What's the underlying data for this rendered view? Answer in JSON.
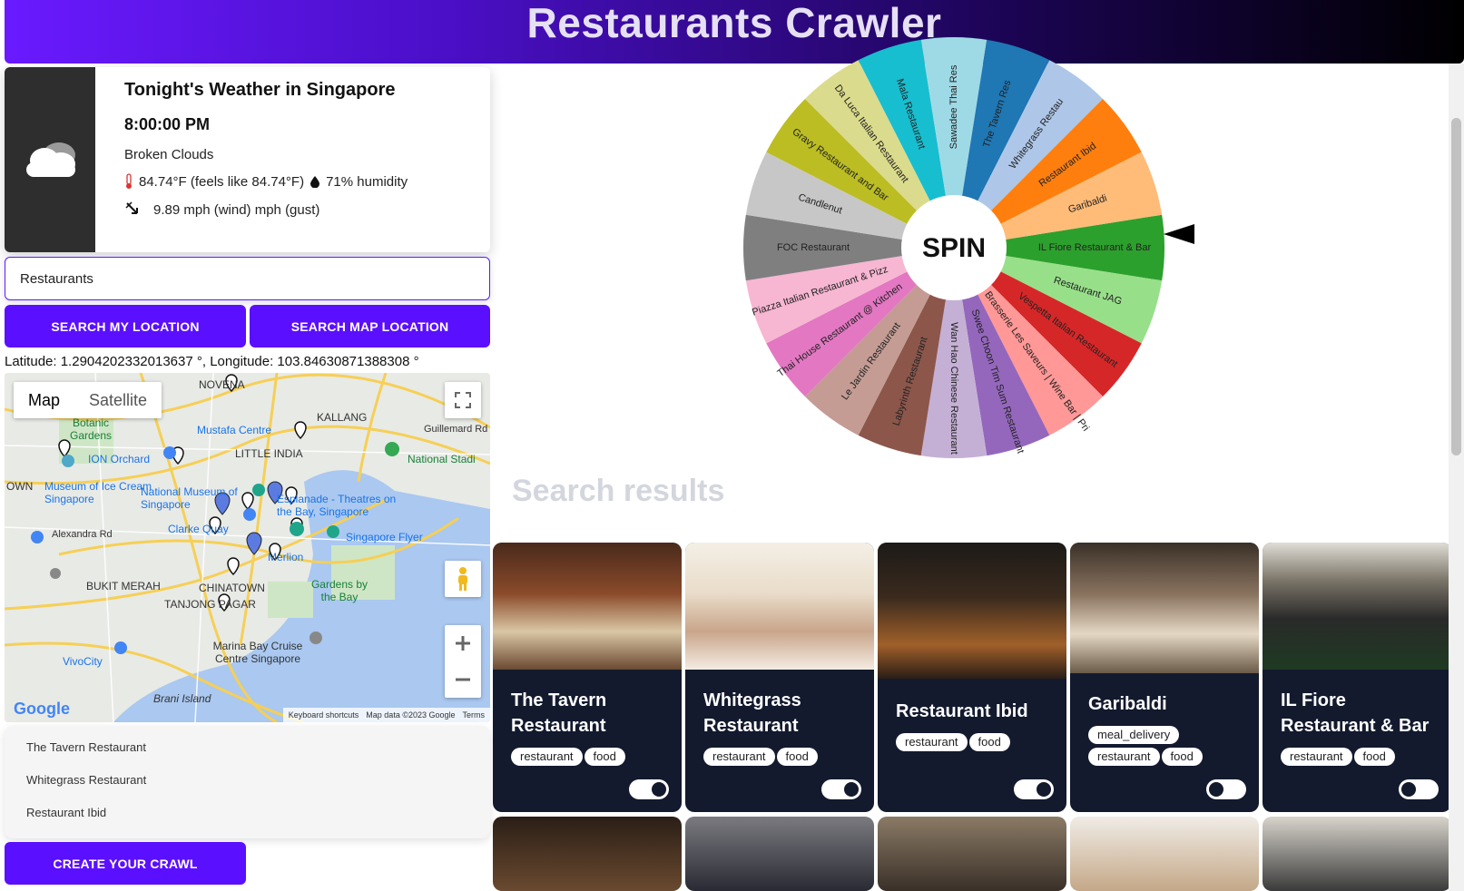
{
  "header": {
    "title": "Restaurants Crawler"
  },
  "weather": {
    "title": "Tonight's Weather in Singapore",
    "time": "8:00:00 PM",
    "description": "Broken Clouds",
    "temp_line": "84.74°F (feels like 84.74°F)",
    "humidity_line": "71% humidity",
    "wind_line": "9.89 mph (wind) mph (gust)"
  },
  "search": {
    "value": "Restaurants",
    "placeholder": ""
  },
  "buttons": {
    "search_my_location": "SEARCH MY LOCATION",
    "search_map_location": "SEARCH MAP LOCATION",
    "create_crawl": "CREATE YOUR CRAWL"
  },
  "coords": "Latitude: 1.2904202332013637 °, Longitude: 103.84630871388308 °",
  "map": {
    "toggle_map": "Map",
    "toggle_satellite": "Satellite",
    "labels": {
      "novena": "NOVENA",
      "botanic": "Botanic Gardens",
      "mustafa": "Mustafa Centre",
      "kallang": "KALLANG",
      "guillemard": "Guillemard Rd",
      "little_india": "LITTLE INDIA",
      "national_stadium": "National Stadi",
      "ion": "ION Orchard",
      "museum": "Museum of Ice Cream Singapore",
      "national_museum": "National Museum of Singapore",
      "esplanade": "Esplanade - Theatres on the Bay, Singapore",
      "clarke": "Clarke Quay",
      "merlion": "Merlion",
      "flyer": "Singapore Flyer",
      "alexandra": "Alexandra Rd",
      "bukit_merah": "BUKIT MERAH",
      "chinatown": "CHINATOWN",
      "tanjong": "TANJONG PAGAR",
      "gardens_bay": "Gardens by the Bay",
      "marina": "Marina Bay Cruise Centre Singapore",
      "vivocity": "VivoCity",
      "brani": "Brani Island",
      "town": "OWN"
    },
    "footer": {
      "shortcuts": "Keyboard shortcuts",
      "data": "Map data ©2023 Google",
      "terms": "Terms"
    },
    "logo": "Google"
  },
  "selected_list": [
    "The Tavern Restaurant",
    "Whitegrass Restaurant",
    "Restaurant Ibid"
  ],
  "wheel": {
    "center_label": "SPIN",
    "segments": [
      {
        "label": "IL Fiore Restaurant & Bar",
        "color": "#2ca02c"
      },
      {
        "label": "Restaurant JAG",
        "color": "#98df8a"
      },
      {
        "label": "Vespetta Italian Restaurant",
        "color": "#d62728"
      },
      {
        "label": "Brasserie Les Saveurs | Wine Bar | Pri",
        "color": "#ff9896"
      },
      {
        "label": "Swee Choon Tim Sum Restaurant",
        "color": "#9467bd"
      },
      {
        "label": "Wan Hao Chinese Restaurant",
        "color": "#c5b0d5"
      },
      {
        "label": "Labyrinth Restaurant",
        "color": "#8c564b"
      },
      {
        "label": "Le Jardin Restaurant",
        "color": "#c49c94"
      },
      {
        "label": "Thai House Restaurant @ Kitchen",
        "color": "#e377c2"
      },
      {
        "label": "Piazza Italian Restaurant & Pizz",
        "color": "#f7b6d2"
      },
      {
        "label": "FOC Restaurant",
        "color": "#7f7f7f"
      },
      {
        "label": "Candlenut",
        "color": "#c7c7c7"
      },
      {
        "label": "Gravy Restaurant and Bar",
        "color": "#bcbd22"
      },
      {
        "label": "Da Luca Italian Restaurant",
        "color": "#dbdb8d"
      },
      {
        "label": "Mala Restaurant",
        "color": "#17becf"
      },
      {
        "label": "Sawadee Thai Res",
        "color": "#9edae5"
      },
      {
        "label": "The Tavern Res",
        "color": "#1f77b4"
      },
      {
        "label": "Whitegrass Restau",
        "color": "#aec7e8"
      },
      {
        "label": "Restaurant Ibid",
        "color": "#ff7f0e"
      },
      {
        "label": "Garibaldi",
        "color": "#ffbb78"
      }
    ]
  },
  "results_heading": "Search results",
  "results": [
    {
      "name": "The Tavern Restaurant",
      "tags": [
        "restaurant",
        "food"
      ],
      "toggle": "on"
    },
    {
      "name": "Whitegrass Restaurant",
      "tags": [
        "restaurant",
        "food"
      ],
      "toggle": "on"
    },
    {
      "name": "Restaurant Ibid",
      "tags": [
        "restaurant",
        "food"
      ],
      "toggle": "on"
    },
    {
      "name": "Garibaldi",
      "tags": [
        "meal_delivery",
        "restaurant",
        "food"
      ],
      "toggle": "off"
    },
    {
      "name": "IL Fiore Restaurant & Bar",
      "tags": [
        "restaurant",
        "food"
      ],
      "toggle": "off"
    }
  ],
  "icons": {
    "weather": "cloud-icon",
    "temperature": "thermometer-icon",
    "humidity": "droplet-icon",
    "wind": "wind-arrow-icon",
    "fullscreen": "fullscreen-icon",
    "pegman": "street-view-icon",
    "zoom_in": "plus-icon",
    "zoom_out": "minus-icon"
  }
}
